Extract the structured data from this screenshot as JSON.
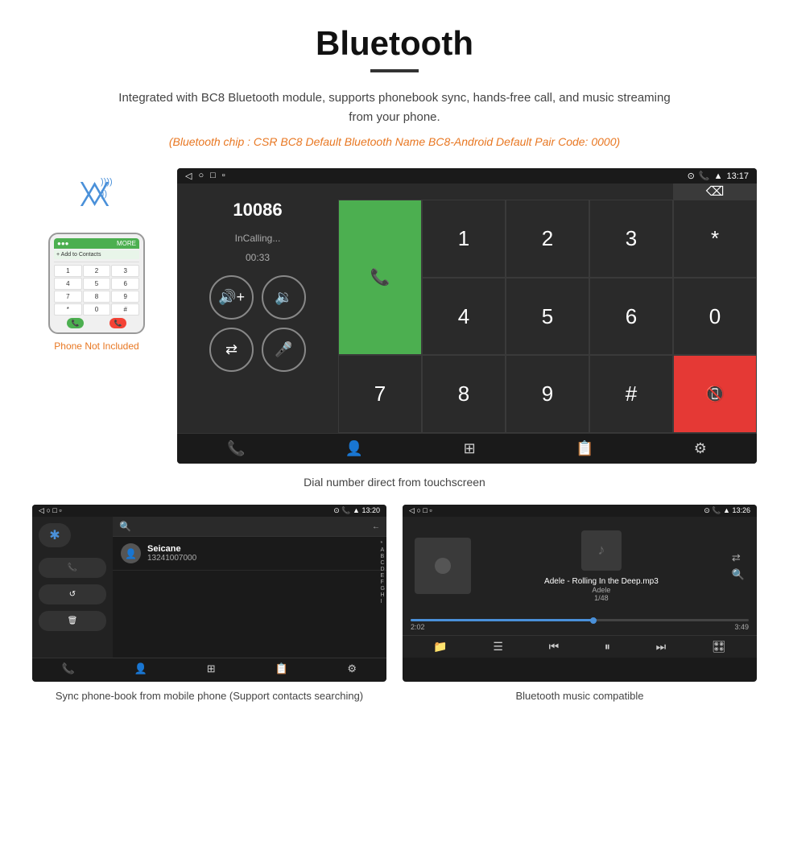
{
  "page": {
    "title": "Bluetooth",
    "subtitle": "Integrated with BC8 Bluetooth module, supports phonebook sync, hands-free call, and music streaming from your phone.",
    "orange_note": "(Bluetooth chip : CSR BC8    Default Bluetooth Name BC8-Android    Default Pair Code: 0000)",
    "dialer_caption": "Dial number direct from touchscreen",
    "phonebook_caption": "Sync phone-book from mobile phone\n(Support contacts searching)",
    "music_caption": "Bluetooth music compatible"
  },
  "dialer_screen": {
    "status_left": [
      "◁",
      "○",
      "□",
      "▫"
    ],
    "status_right": "13:17",
    "number": "10086",
    "in_calling": "InCalling...",
    "timer": "00:33",
    "keys": [
      "1",
      "2",
      "3",
      "*",
      "4",
      "5",
      "6",
      "0",
      "7",
      "8",
      "9",
      "#"
    ]
  },
  "phonebook_screen": {
    "status_right": "13:20",
    "contact_name": "Seicane",
    "contact_number": "13241007000",
    "alphabet": [
      "*",
      "A",
      "B",
      "C",
      "D",
      "E",
      "F",
      "G",
      "H",
      "I"
    ]
  },
  "music_screen": {
    "status_right": "13:26",
    "song_title": "Adele - Rolling In the Deep.mp3",
    "artist": "Adele",
    "track_info": "1/48",
    "time_current": "2:02",
    "time_total": "3:49",
    "progress_percent": 55
  },
  "phone_widget": {
    "not_included": "Phone Not Included"
  }
}
